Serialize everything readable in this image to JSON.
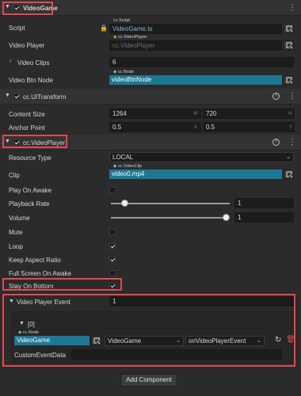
{
  "sections": {
    "videogame": {
      "title": "VideoGame"
    },
    "uitransform": {
      "title": "cc.UITransform"
    },
    "videoplayer": {
      "title": "cc.VideoPlayer"
    }
  },
  "videogame": {
    "script_label": "Script",
    "script_tag": "cc.Script",
    "script_value": "VideoGame.ts",
    "video_player_label": "Video Player",
    "video_player_tag": "cc.VideoPlayer",
    "video_player_value": "cc.VideoPlayer",
    "video_clips_label": "Video Clips",
    "video_clips_value": "6",
    "video_btn_label": "Video Btn Node",
    "video_btn_tag": "cc.Node",
    "video_btn_value": "videoBtnNode"
  },
  "uitransform": {
    "content_size_label": "Content Size",
    "width": "1264",
    "width_unit": "W",
    "height": "720",
    "height_unit": "H",
    "anchor_label": "Anchor Point",
    "anchor_x": "0.5",
    "anchor_x_unit": "X",
    "anchor_y": "0.5",
    "anchor_y_unit": "Y"
  },
  "videoplayer": {
    "resource_type_label": "Resource Type",
    "resource_type_value": "LOCAL",
    "clip_label": "Clip",
    "clip_tag": "cc.VideoClip",
    "clip_value": "video0.mp4",
    "play_on_awake_label": "Play On Awake",
    "play_on_awake": false,
    "playback_rate_label": "Playback Rate",
    "playback_rate_value": "1",
    "playback_rate_slider": 0.09,
    "volume_label": "Volume",
    "volume_value": "1",
    "volume_slider": 1.0,
    "mute_label": "Mute",
    "mute": false,
    "loop_label": "Loop",
    "loop": true,
    "keep_aspect_label": "Keep Aspect Ratio",
    "keep_aspect": true,
    "full_screen_label": "Full Screen On Awake",
    "full_screen": false,
    "stay_on_bottom_label": "Stay On Bottom",
    "stay_on_bottom": true
  },
  "event": {
    "label": "Video Player Event",
    "count": "1",
    "index_label": "[0]",
    "node_tag": "cc.Node",
    "node_value": "VideoGame",
    "component_value": "VideoGame",
    "handler_value": "onVideoPlayerEvent",
    "custom_label": "CustomEventData",
    "custom_value": ""
  },
  "add_component_label": "Add Component",
  "colors": {
    "accent": "#1e7894",
    "highlight": "#e5484d"
  }
}
